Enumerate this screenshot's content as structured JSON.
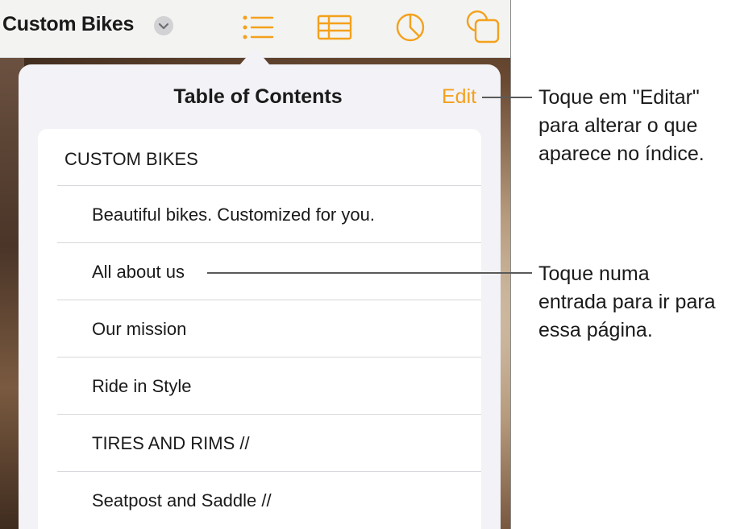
{
  "toolbar": {
    "document_title": "Custom Bikes",
    "icons": [
      "list-icon",
      "table-icon",
      "chart-icon",
      "shape-icon"
    ],
    "accent_color": "#f4a11b"
  },
  "popover": {
    "title": "Table of Contents",
    "edit_label": "Edit",
    "items": [
      {
        "label": "CUSTOM  BIKES",
        "level": 1
      },
      {
        "label": "Beautiful bikes. Customized for you.",
        "level": 2
      },
      {
        "label": "All about us",
        "level": 2
      },
      {
        "label": "Our mission",
        "level": 2
      },
      {
        "label": "Ride in Style",
        "level": 2
      },
      {
        "label": "TIRES AND RIMS //",
        "level": 2
      },
      {
        "label": "Seatpost and Saddle //",
        "level": 2
      }
    ]
  },
  "callouts": {
    "edit": "Toque em \"Editar\" para alterar o que aparece no índice.",
    "entry": "Toque numa entrada para ir para essa página."
  }
}
